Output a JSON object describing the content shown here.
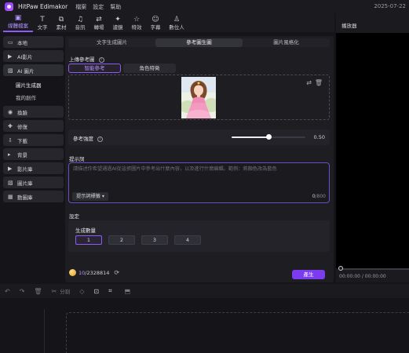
{
  "titlebar": {
    "app_name": "HitPaw Edimakor",
    "menu": [
      "檔案",
      "設定",
      "幫助"
    ],
    "date": "2025-07-22"
  },
  "toolbar": {
    "items": [
      {
        "label": "媒體檔案",
        "icon": "media-icon",
        "glyph": "▣"
      },
      {
        "label": "文字",
        "icon": "text-icon",
        "glyph": "T"
      },
      {
        "label": "素材",
        "icon": "assets-icon",
        "glyph": "⧉"
      },
      {
        "label": "音訊",
        "icon": "music-icon",
        "glyph": "♫"
      },
      {
        "label": "轉場",
        "icon": "transition-icon",
        "glyph": "⇄"
      },
      {
        "label": "濾鏡",
        "icon": "filter-icon",
        "glyph": "✦"
      },
      {
        "label": "特效",
        "icon": "effects-icon",
        "glyph": "☆"
      },
      {
        "label": "字幕",
        "icon": "subtitle-icon",
        "glyph": "☺"
      },
      {
        "label": "數位人",
        "icon": "avatar-icon",
        "glyph": "♙"
      }
    ]
  },
  "sidebar": {
    "items": [
      {
        "label": "本地",
        "icon": "folder-icon",
        "glyph": "▭"
      },
      {
        "label": "AI影片",
        "icon": "ai-video-icon",
        "glyph": "▶"
      },
      {
        "label": "AI 圖片",
        "icon": "ai-image-icon",
        "glyph": "▨"
      },
      {
        "label": "換臉",
        "icon": "face-swap-icon",
        "glyph": "◉"
      },
      {
        "label": "修復",
        "icon": "repair-icon",
        "glyph": "✚"
      },
      {
        "label": "下載",
        "icon": "download-icon",
        "glyph": "⇩"
      },
      {
        "label": "背景",
        "icon": "background-icon",
        "glyph": "▸"
      },
      {
        "label": "影片庫",
        "icon": "video-library-icon",
        "glyph": "▶"
      },
      {
        "label": "圖片庫",
        "icon": "image-library-icon",
        "glyph": "▨"
      },
      {
        "label": "動圖庫",
        "icon": "gif-library-icon",
        "glyph": "▦"
      }
    ],
    "sub_items": [
      "圖片生成器",
      "我的創作"
    ]
  },
  "main": {
    "tabs": [
      "文字生成圖片",
      "參考圖生圖",
      "圖片風格化"
    ],
    "upload_label": "上傳參考圖",
    "ref_tabs": [
      "智能參考",
      "角色特徵"
    ],
    "strength_label": "參考強度",
    "strength_value": "0.50",
    "strength_fraction": 0.5,
    "prompt_label": "提示詞",
    "prompt_placeholder": "請描述你希望通過AI從這張圖片中參考出什麼內容，以及進行什麼編輯。範例：將顏色改為藍色",
    "prompt_tag": "提示詞標籤",
    "prompt_count_current": "0",
    "prompt_count_max": "/800",
    "settings_label": "設定",
    "count_label": "生成數量",
    "count_options": [
      "1",
      "2",
      "3",
      "4"
    ],
    "credits_used": "10",
    "credits_total": "/2328814",
    "generate_label": "產生"
  },
  "player": {
    "title": "播放器",
    "time": "00:00:00 / 00:00:00"
  },
  "timeline": {
    "split_label": "分割"
  }
}
